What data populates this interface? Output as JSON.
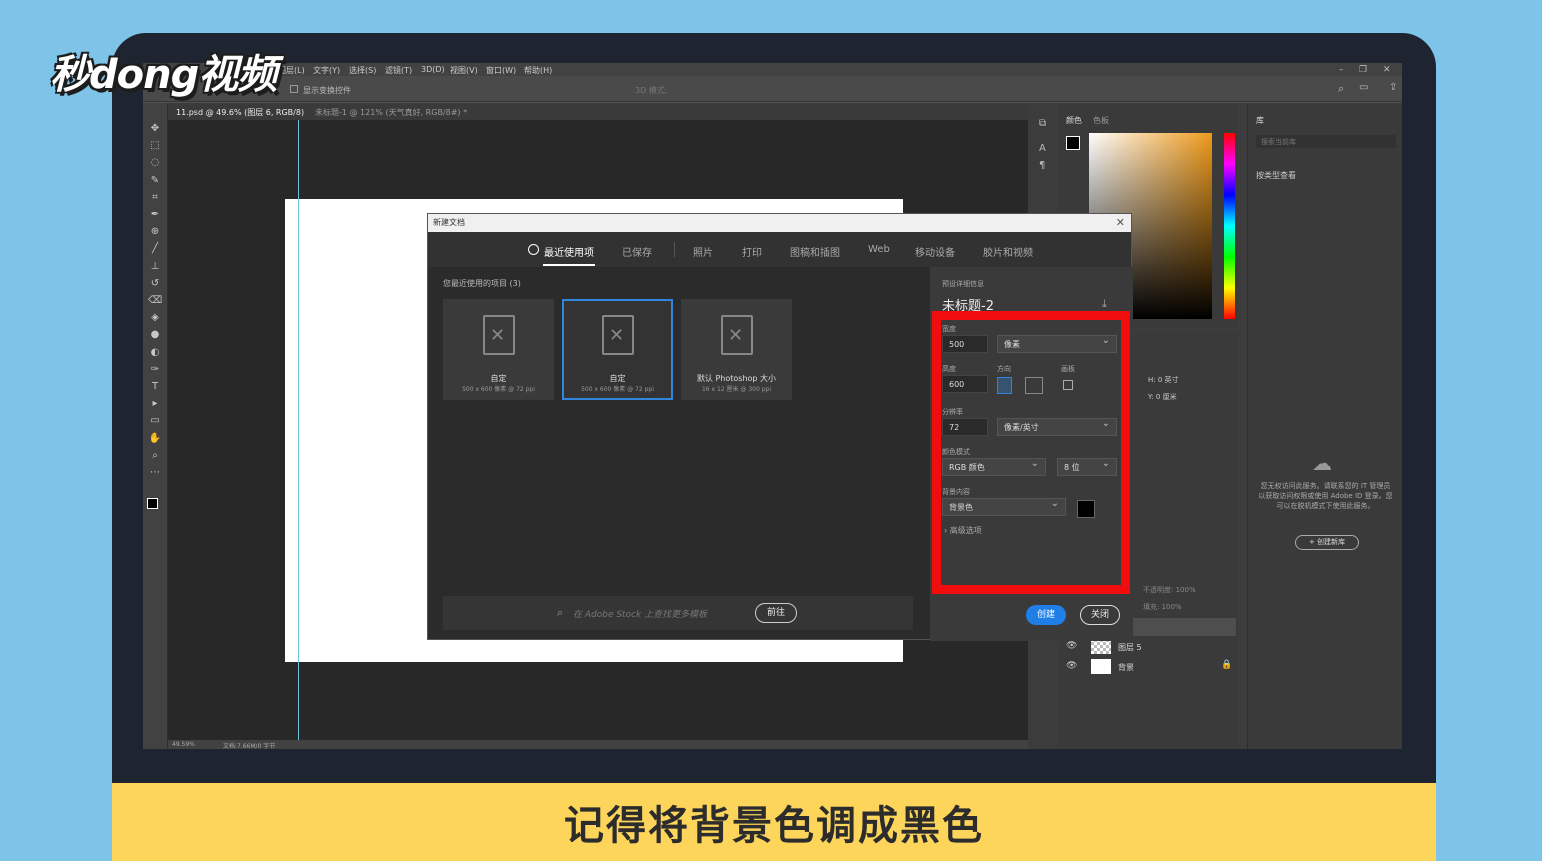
{
  "branding": {
    "logo": "秒dong视频"
  },
  "subtitle": "记得将背景色调成黑色",
  "ps": {
    "menu": [
      "图层(L)",
      "文字(Y)",
      "选择(S)",
      "滤镜(T)",
      "3D(D)",
      "视图(V)",
      "窗口(W)",
      "帮助(H)"
    ],
    "window_controls": [
      "–",
      "❐",
      "✕"
    ],
    "options": {
      "show_transform": "显示变换控件",
      "mode_3d": "3D 模式:"
    },
    "doc_tabs": [
      "11.psd @ 49.6% (图层 6, RGB/8)",
      "未标题-1 @ 121% (天气真好, RGB/8#) *"
    ],
    "status": {
      "zoom": "49.59%",
      "doc_info": "文档:7.66M/0 字节"
    },
    "tools": [
      "move-tool-icon",
      "marquee-tool-icon",
      "lasso-tool-icon",
      "quick-select-icon",
      "crop-tool-icon",
      "eyedropper-icon",
      "healing-brush-icon",
      "brush-tool-icon",
      "stamp-tool-icon",
      "history-brush-icon",
      "eraser-icon",
      "paint-bucket-icon",
      "blur-tool-icon",
      "dodge-tool-icon",
      "pen-tool-icon",
      "type-tool-icon",
      "path-select-icon",
      "rectangle-tool-icon",
      "hand-tool-icon",
      "zoom-tool-icon",
      "more-tools-icon"
    ]
  },
  "dialog": {
    "title": "新建文档",
    "close": "✕",
    "tabs": [
      "最近使用项",
      "已保存",
      "照片",
      "打印",
      "图稿和插图",
      "Web",
      "移动设备",
      "胶片和视频"
    ],
    "recent_title": "您最近使用的项目 (3)",
    "cards": [
      {
        "name": "自定",
        "sub": "500 x 600 像素 @ 72 ppi",
        "selected": false
      },
      {
        "name": "自定",
        "sub": "500 x 600 像素 @ 72 ppi",
        "selected": true
      },
      {
        "name": "默认 Photoshop 大小",
        "sub": "16 x 12 厘米 @ 300 ppi",
        "selected": false
      }
    ],
    "search_placeholder": "在 Adobe Stock 上查找更多模板",
    "go_label": "前往",
    "preset": {
      "section_label": "预设详细信息",
      "doc_name": "未标题-2",
      "width_label": "宽度",
      "width_value": "500",
      "width_unit": "像素",
      "height_label": "高度",
      "height_value": "600",
      "orientation_label": "方向",
      "artboard_label": "画板",
      "resolution_label": "分辨率",
      "resolution_value": "72",
      "resolution_unit": "像素/英寸",
      "color_mode_label": "颜色模式",
      "color_mode": "RGB 颜色",
      "bit_depth": "8 位",
      "background_label": "背景内容",
      "background_value": "背景色",
      "background_swatch": "#000000",
      "advanced": "高级选项"
    },
    "create_label": "创建",
    "close_label": "关闭"
  },
  "panels": {
    "color_tabs": [
      "颜色",
      "色板"
    ],
    "library_tab": "库",
    "library_search": "搜索当前库",
    "library_view": "按类型查看",
    "library_msg": "您无权访问此服务。请联系您的 IT 管理员以获取访问权限或使用 Adobe ID 登录。您可以在脱机模式下使用此服务。",
    "library_btn": "+ 创建新库",
    "props": {
      "h": "H: 0 英寸",
      "y": "Y: 0 厘米"
    },
    "layers": [
      {
        "name": "图层 5",
        "thumb": "checker"
      },
      {
        "name": "背景",
        "thumb": "white",
        "locked": true
      }
    ],
    "layer_opacity": "不透明度: 100%",
    "layer_fill": "填充: 100%"
  }
}
